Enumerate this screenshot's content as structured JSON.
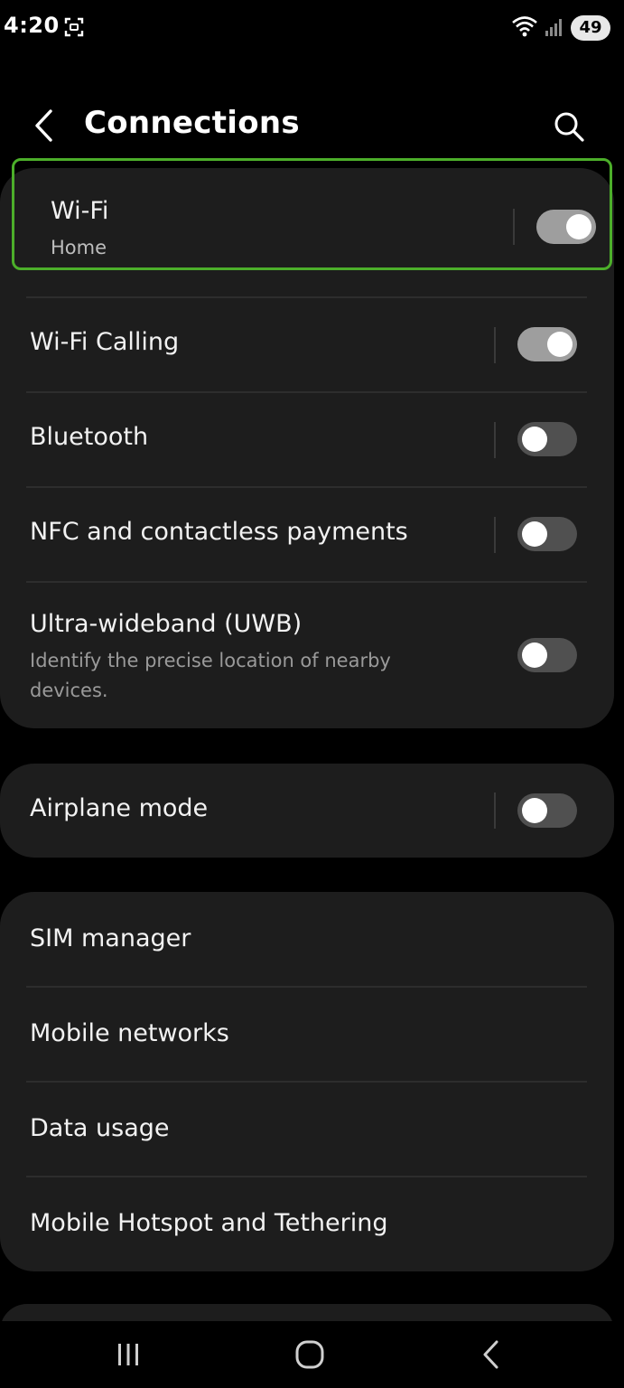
{
  "status_bar": {
    "time": "4:20",
    "battery": "49",
    "icons": [
      "screenshot-icon",
      "wifi-icon",
      "signal-icon",
      "battery-icon"
    ]
  },
  "header": {
    "title": "Connections",
    "back_icon": "chevron-left-icon",
    "search_icon": "search-icon"
  },
  "sections": {
    "wifi": {
      "label": "Wi-Fi",
      "sub": "Home",
      "on": true
    },
    "wifi_calling": {
      "label": "Wi-Fi Calling",
      "on": true
    },
    "bluetooth": {
      "label": "Bluetooth",
      "on": false
    },
    "nfc": {
      "label": "NFC and contactless payments",
      "on": false
    },
    "uwb": {
      "label": "Ultra-wideband (UWB)",
      "sub": "Identify the precise location of nearby devices.",
      "on": false
    },
    "airplane": {
      "label": "Airplane mode",
      "on": false
    },
    "sim_manager": {
      "label": "SIM manager"
    },
    "mobile_networks": {
      "label": "Mobile networks"
    },
    "data_usage": {
      "label": "Data usage"
    },
    "hotspot": {
      "label": "Mobile Hotspot and Tethering"
    }
  },
  "colors": {
    "highlight": "#4caf2a",
    "card": "#1d1d1d",
    "toggle_on": "#9e9e9e",
    "toggle_off": "#505050"
  },
  "nav_bar": {
    "icons": [
      "recent-apps-icon",
      "home-icon",
      "back-icon"
    ]
  }
}
